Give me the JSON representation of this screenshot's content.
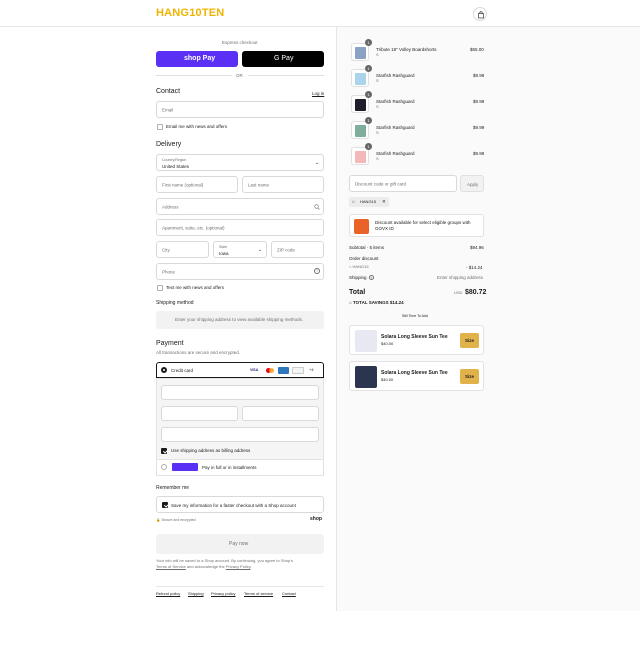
{
  "header": {
    "logo_text": "HANG10TEN"
  },
  "express": {
    "label": "Express checkout",
    "shop_pay": "shop Pay",
    "gpay": "G Pay",
    "or": "OR"
  },
  "contact": {
    "title": "Contact",
    "login": "Log in",
    "email_placeholder": "Email",
    "news_label": "Email me with news and offers"
  },
  "delivery": {
    "title": "Delivery",
    "country_label": "Country/Region",
    "country_value": "United States",
    "first_name": "First name (optional)",
    "last_name": "Last name",
    "address": "Address",
    "apartment": "Apartment, suite, etc. (optional)",
    "city": "City",
    "state_label": "State",
    "state_value": "Iowa",
    "zip": "ZIP code",
    "phone": "Phone",
    "text_news": "Text me with news and offers"
  },
  "shipping_method": {
    "title": "Shipping method",
    "note": "Enter your shipping address to view available shipping methods."
  },
  "payment": {
    "title": "Payment",
    "subtitle": "All transactions are secure and encrypted.",
    "credit_card": "Credit card",
    "card_more": "+4",
    "billing_same": "Use shipping address as billing address",
    "shoppay_label": "Pay in full or in installments"
  },
  "remember": {
    "title": "Remember me",
    "save_label": "Save my information for a faster checkout with a Shop account",
    "secure": "Secure and encrypted",
    "shop_logo": "shop"
  },
  "pay_now": "Pay now",
  "legal": {
    "line1": "Your info will be saved to a Shop account. By continuing, you agree to Shop's",
    "tos": "Terms of Service",
    "mid": " and acknowledge the ",
    "privacy": "Privacy Policy",
    "end": "."
  },
  "footer_links": [
    "Refund policy",
    "Shipping",
    "Privacy policy",
    "Terms of service",
    "Contact"
  ],
  "cart": {
    "items": [
      {
        "name": "Tribute 18\" Volley Boardshorts",
        "variant": "S",
        "price": "$55.00",
        "qty": "1"
      },
      {
        "name": "Starfish Rashguard",
        "variant": "S",
        "price": "$9.99",
        "qty": "1"
      },
      {
        "name": "Starfish Rashguard",
        "variant": "S",
        "price": "$9.99",
        "qty": "1"
      },
      {
        "name": "Starfish Rashguard",
        "variant": "S",
        "price": "$9.99",
        "qty": "1"
      },
      {
        "name": "Starfish Rashguard",
        "variant": "S",
        "price": "$9.99",
        "qty": "1"
      }
    ],
    "discount_placeholder": "Discount code or gift card",
    "apply": "Apply",
    "code_tag": "HANG15",
    "govx_text": "Discount available for select eligible groups with GOVX ID",
    "subtotal_label": "Subtotal · 5 items",
    "subtotal_value": "$94.96",
    "order_discount": "Order discount",
    "discount_code": "HANG15",
    "discount_value": "- $14.24",
    "shipping_label": "Shipping",
    "shipping_value": "Enter shipping address",
    "total_label": "Total",
    "currency": "USD",
    "total_value": "$80.72",
    "savings_label": "TOTAL SAVINGS",
    "savings_value": "$14.24",
    "add_label": "Still Time To Add",
    "upsells": [
      {
        "name": "Solara Long Sleeve Sun Tee",
        "price": "$40.00",
        "button": "Size"
      },
      {
        "name": "Solara Long Sleeve Sun Tee",
        "price": "$40.00",
        "button": "Size"
      }
    ]
  },
  "colors": {
    "accent": "#f0b400",
    "shop_pay": "#5a31f4",
    "size_button": "#e2b24a"
  }
}
